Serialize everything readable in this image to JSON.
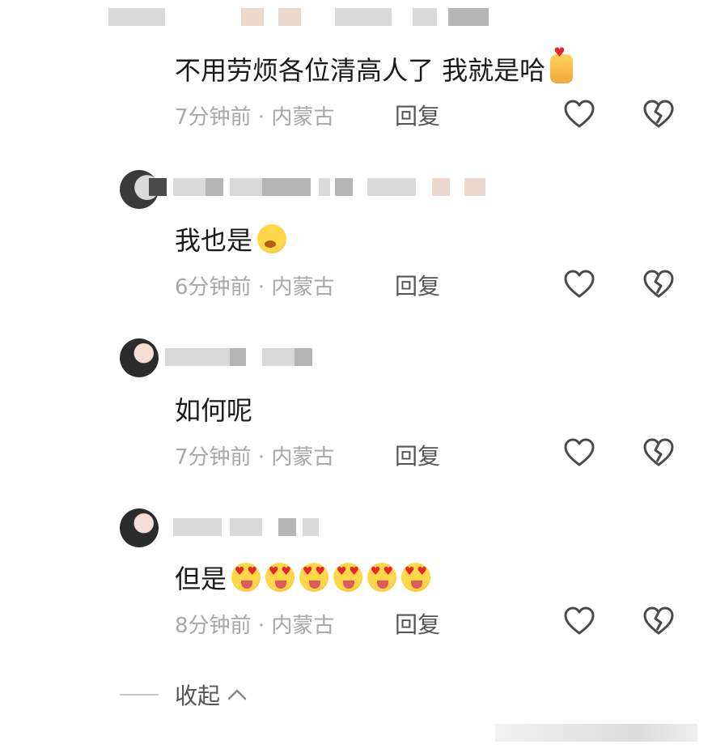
{
  "comments": [
    {
      "text": "不用劳烦各位清高人了 我就是哈",
      "emoji": [
        "pinched-heart-hand-emoji"
      ],
      "meta": "7分钟前 · 内蒙古",
      "reply_label": "回复"
    },
    {
      "text": "我也是",
      "emoji": [
        "sleepy-face-emoji"
      ],
      "meta": "6分钟前 · 内蒙古",
      "reply_label": "回复"
    },
    {
      "text": "如何呢",
      "emoji": [],
      "meta": "7分钟前 · 内蒙古",
      "reply_label": "回复"
    },
    {
      "text": "但是",
      "emoji": [
        "heart-eyes-tongue-emoji",
        "heart-eyes-tongue-emoji",
        "heart-eyes-tongue-emoji",
        "heart-eyes-tongue-emoji",
        "heart-eyes-tongue-emoji",
        "heart-eyes-tongue-emoji"
      ],
      "meta": "8分钟前 · 内蒙古",
      "reply_label": "回复"
    }
  ],
  "collapse_label": "收起",
  "icons": {
    "like": "heart-outline-icon",
    "dislike": "broken-heart-outline-icon",
    "collapse": "chevron-up-icon"
  },
  "colors": {
    "text": "#1a1a1a",
    "meta": "#a7a7a7",
    "icon": "#4a4a4a"
  }
}
